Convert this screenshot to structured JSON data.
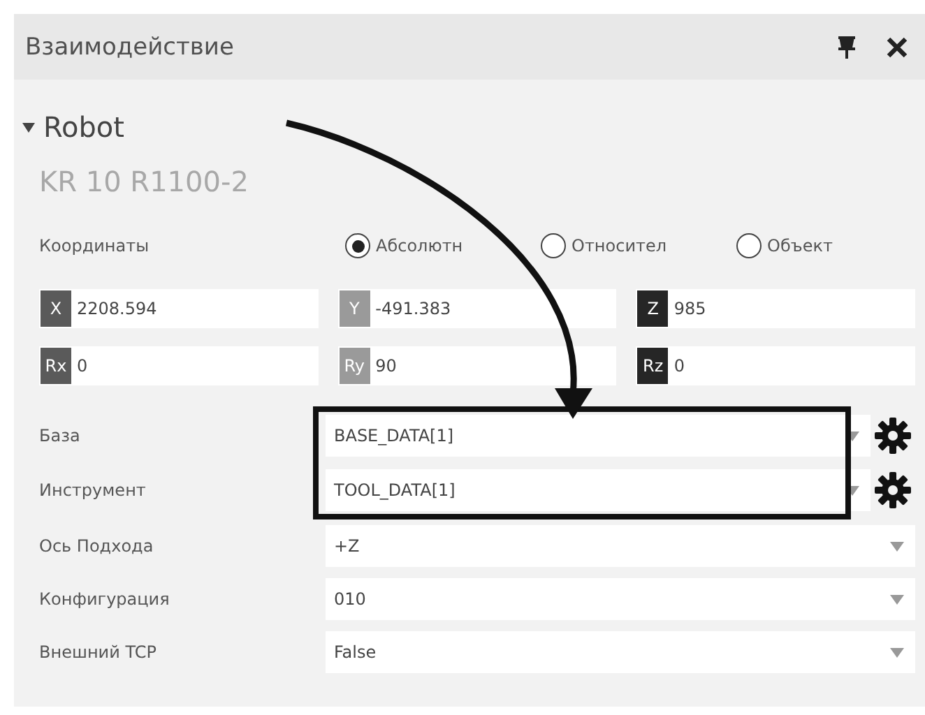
{
  "panel": {
    "title": "Взаимодействие"
  },
  "robot": {
    "name": "Robot",
    "expanded": true,
    "model": "KR 10 R1100-2"
  },
  "coordinates": {
    "label": "Координаты",
    "modes": [
      {
        "label": "Абсолютн",
        "selected": true
      },
      {
        "label": "Относител",
        "selected": false
      },
      {
        "label": "Объект",
        "selected": false
      }
    ],
    "fields": [
      {
        "axis": "X",
        "value": "2208.594",
        "color": "#5a5a5a"
      },
      {
        "axis": "Y",
        "value": "-491.383",
        "color": "#9a9a9a"
      },
      {
        "axis": "Z",
        "value": "985",
        "color": "#262626"
      },
      {
        "axis": "Rx",
        "value": "0",
        "color": "#5a5a5a"
      },
      {
        "axis": "Ry",
        "value": "90",
        "color": "#9a9a9a"
      },
      {
        "axis": "Rz",
        "value": "0",
        "color": "#262626"
      }
    ]
  },
  "properties": [
    {
      "label": "База",
      "value": "BASE_DATA[1]",
      "highlighted": true,
      "has_settings": true
    },
    {
      "label": "Инструмент",
      "value": "TOOL_DATA[1]",
      "highlighted": true,
      "has_settings": true
    },
    {
      "label": "Ось Подхода",
      "value": "+Z",
      "highlighted": false,
      "has_settings": false
    },
    {
      "label": "Конфигурация",
      "value": "010",
      "highlighted": false,
      "has_settings": false
    },
    {
      "label": "Внешний TCP",
      "value": "False",
      "highlighted": false,
      "has_settings": false
    }
  ]
}
